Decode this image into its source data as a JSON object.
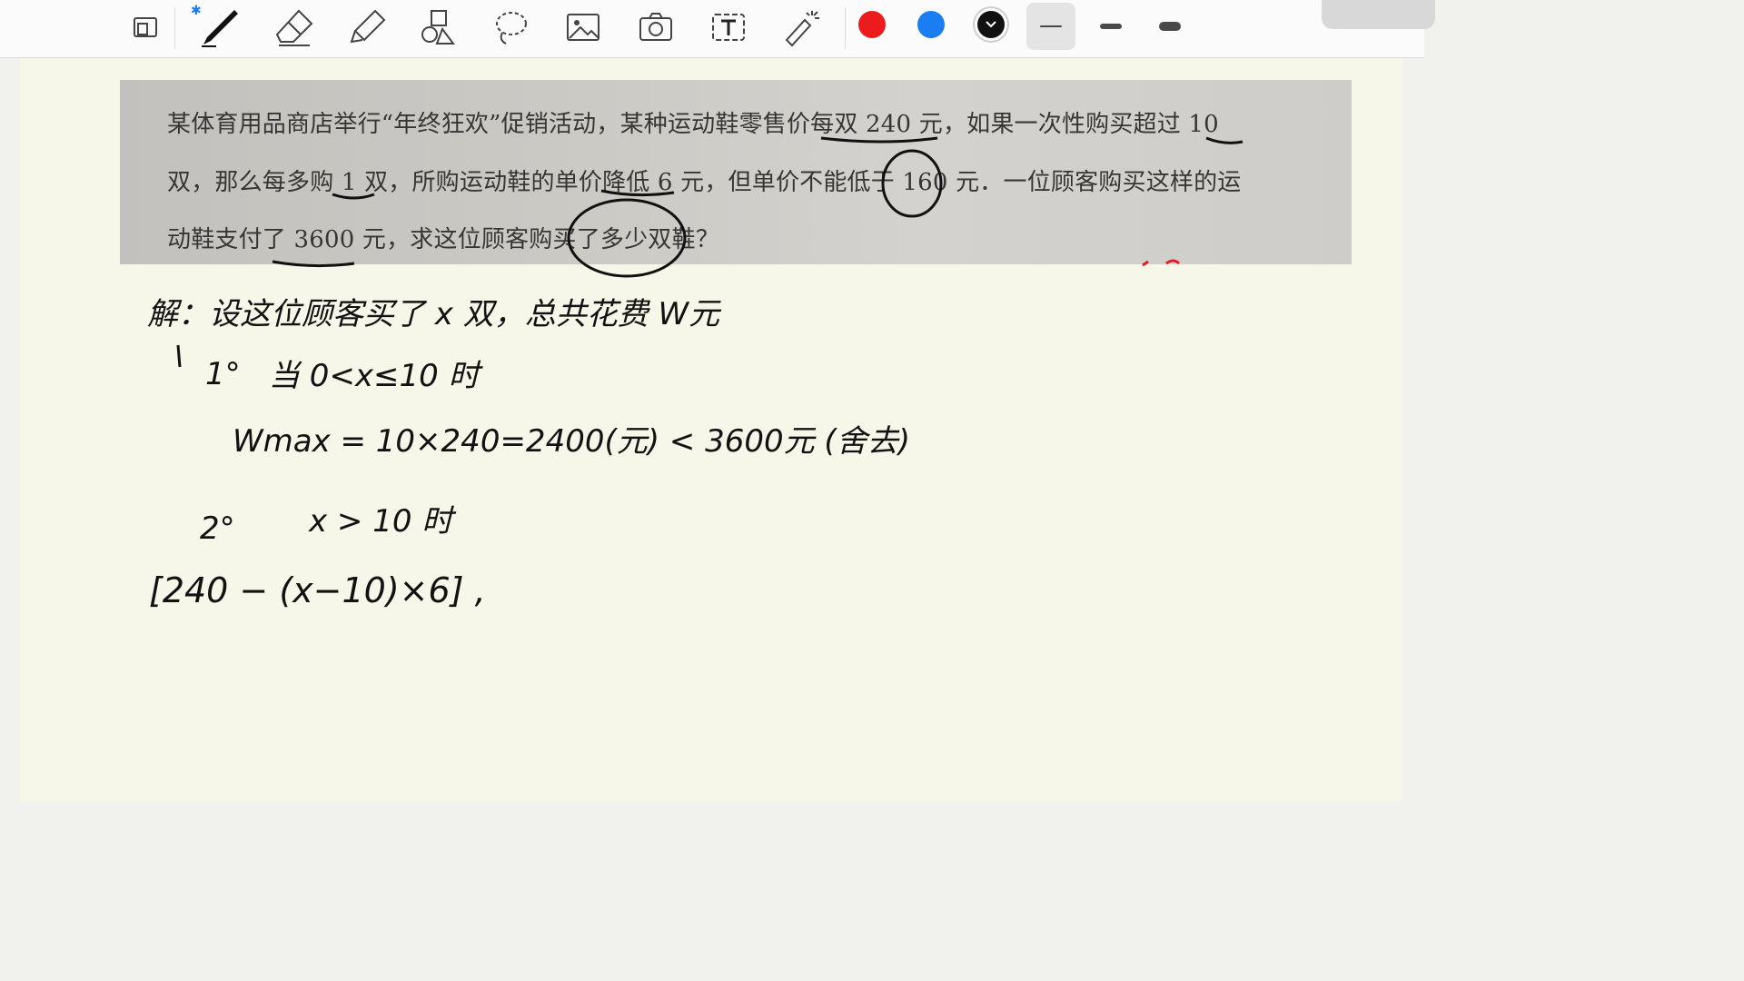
{
  "toolbar": {
    "tools": [
      "page-layout-icon",
      "pen-icon",
      "eraser-icon",
      "highlighter-icon",
      "shapes-icon",
      "lasso-icon",
      "image-icon",
      "camera-icon",
      "text-icon",
      "laser-pointer-icon"
    ],
    "bluetooth_glyph": "✱",
    "colors": [
      "#ec1c1c",
      "#1a7ef2",
      "#111111"
    ],
    "selected_color": "#111111",
    "widths": [
      "thin",
      "medium",
      "thick"
    ],
    "selected_width": "thin"
  },
  "problem": {
    "line1": "某体育用品商店举行“年终狂欢”促销活动，某种运动鞋零售价每双 240 元，如果一次性购买超过 10",
    "line2": "双，那么每多购 1 双，所购运动鞋的单价降低 6 元，但单价不能低于 160 元．一位顾客购买这样的运",
    "line3": "动鞋支付了 3600 元，求这位顾客购买了多少双鞋？"
  },
  "notes": {
    "line1": "解：设这位顾客买了 x 双，总共花费 W元",
    "line2_num": "1°",
    "line2": "当 0<x≤10 时",
    "line3": "Wmax = 10×240=2400(元) < 3600元 (舍去)",
    "line4_num": "2°",
    "line4": "x > 10 时",
    "line5": "[240 − (x−10)×6] ,"
  }
}
